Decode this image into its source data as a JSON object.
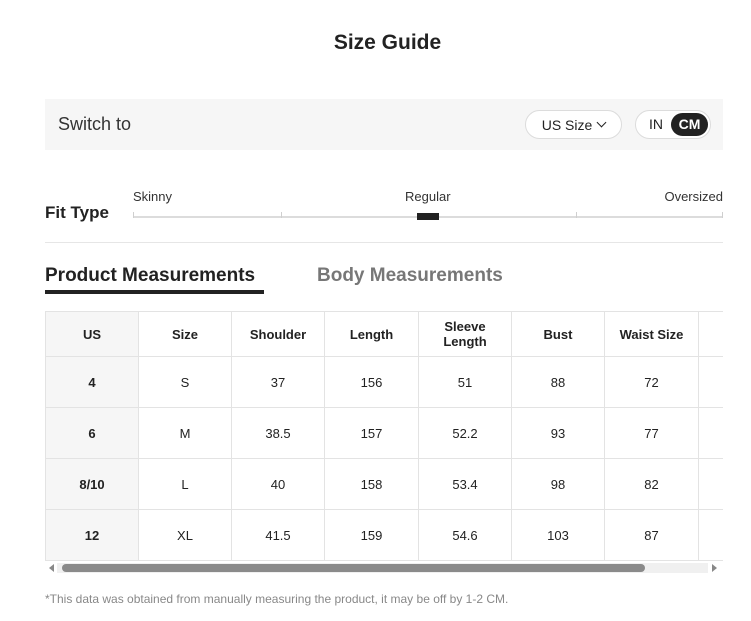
{
  "title": "Size Guide",
  "switch": {
    "label": "Switch to",
    "size_system": "US Size",
    "unit_in": "IN",
    "unit_cm": "CM",
    "active_unit": "CM"
  },
  "fit": {
    "label": "Fit Type",
    "options": [
      "Skinny",
      "Regular",
      "Oversized"
    ],
    "selected": "Regular"
  },
  "tabs": {
    "product": "Product Measurements",
    "body": "Body Measurements",
    "active": "Product Measurements"
  },
  "table": {
    "headers": [
      "US",
      "Size",
      "Shoulder",
      "Length",
      "Sleeve Length",
      "Bust",
      "Waist Size",
      ""
    ],
    "rows": [
      [
        "4",
        "S",
        "37",
        "156",
        "51",
        "88",
        "72",
        ""
      ],
      [
        "6",
        "M",
        "38.5",
        "157",
        "52.2",
        "93",
        "77",
        ""
      ],
      [
        "8/10",
        "L",
        "40",
        "158",
        "53.4",
        "98",
        "82",
        ""
      ],
      [
        "12",
        "XL",
        "41.5",
        "159",
        "54.6",
        "103",
        "87",
        ""
      ]
    ]
  },
  "note": "*This data was obtained from manually measuring the product, it may be off by 1-2 CM.",
  "colors": {
    "accent": "#222222",
    "muted": "#777777",
    "panel": "#f6f6f6"
  }
}
